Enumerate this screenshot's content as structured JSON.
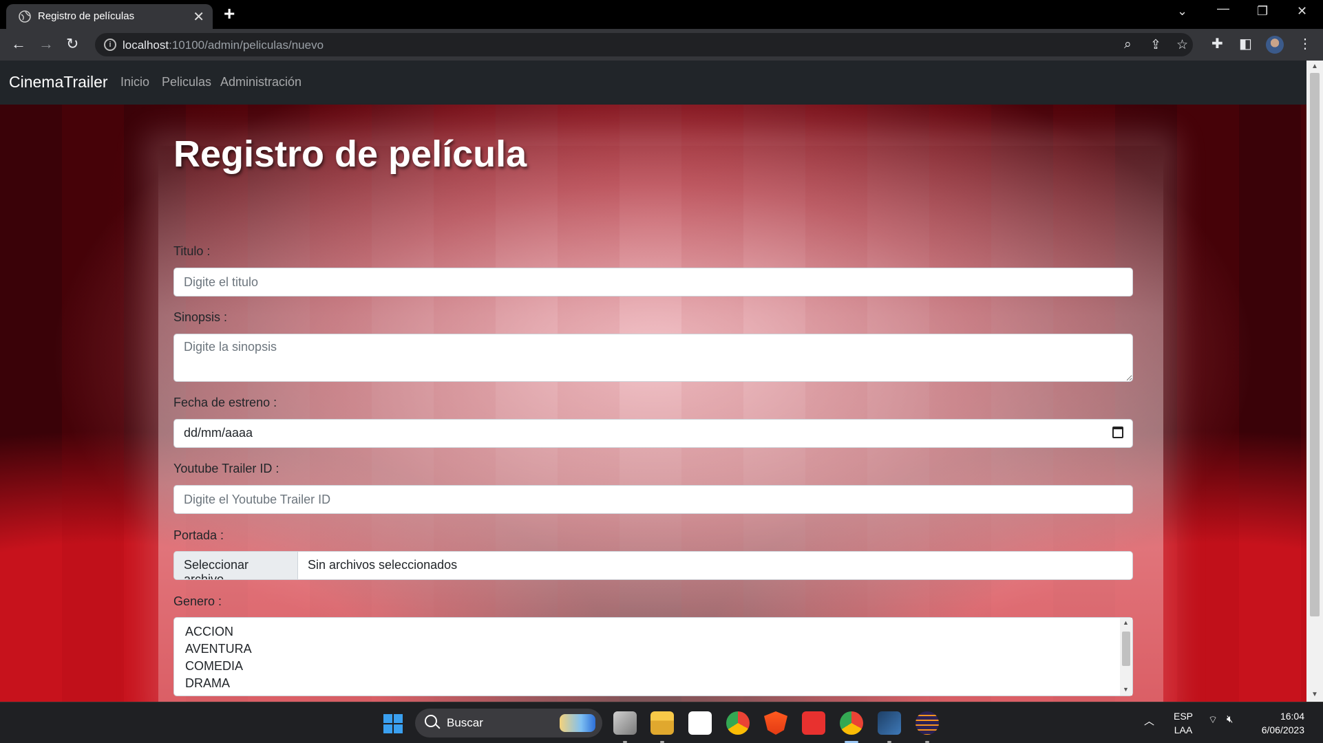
{
  "browser": {
    "tab_title": "Registro de películas",
    "tab_close": "✕",
    "new_tab": "+",
    "url_host": "localhost",
    "url_path": ":10100/admin/peliculas/nuevo"
  },
  "navbar": {
    "brand": "CinemaTrailer",
    "links": [
      "Inicio",
      "Peliculas",
      "Administración"
    ]
  },
  "form": {
    "title": "Registro de película",
    "titulo_label": "Titulo :",
    "titulo_placeholder": "Digite el titulo",
    "sinopsis_label": "Sinopsis :",
    "sinopsis_placeholder": "Digite la sinopsis",
    "fecha_label": "Fecha de estreno :",
    "fecha_value": "dd/mm/aaaa",
    "youtube_label": "Youtube Trailer ID :",
    "youtube_placeholder": "Digite el Youtube Trailer ID",
    "portada_label": "Portada :",
    "file_button": "Seleccionar archivo",
    "file_status": "Sin archivos seleccionados",
    "genero_label": "Genero :",
    "genero_options": [
      "ACCION",
      "AVENTURA",
      "COMEDIA",
      "DRAMA"
    ]
  },
  "taskbar": {
    "search_text": "Buscar",
    "language": "ESP",
    "language_sub": "LAA",
    "time": "16:04",
    "date": "6/06/2023"
  },
  "colors": {
    "navbar_bg": "#212529",
    "chrome_bg": "#35363a",
    "accent_red": "#c7121c"
  }
}
